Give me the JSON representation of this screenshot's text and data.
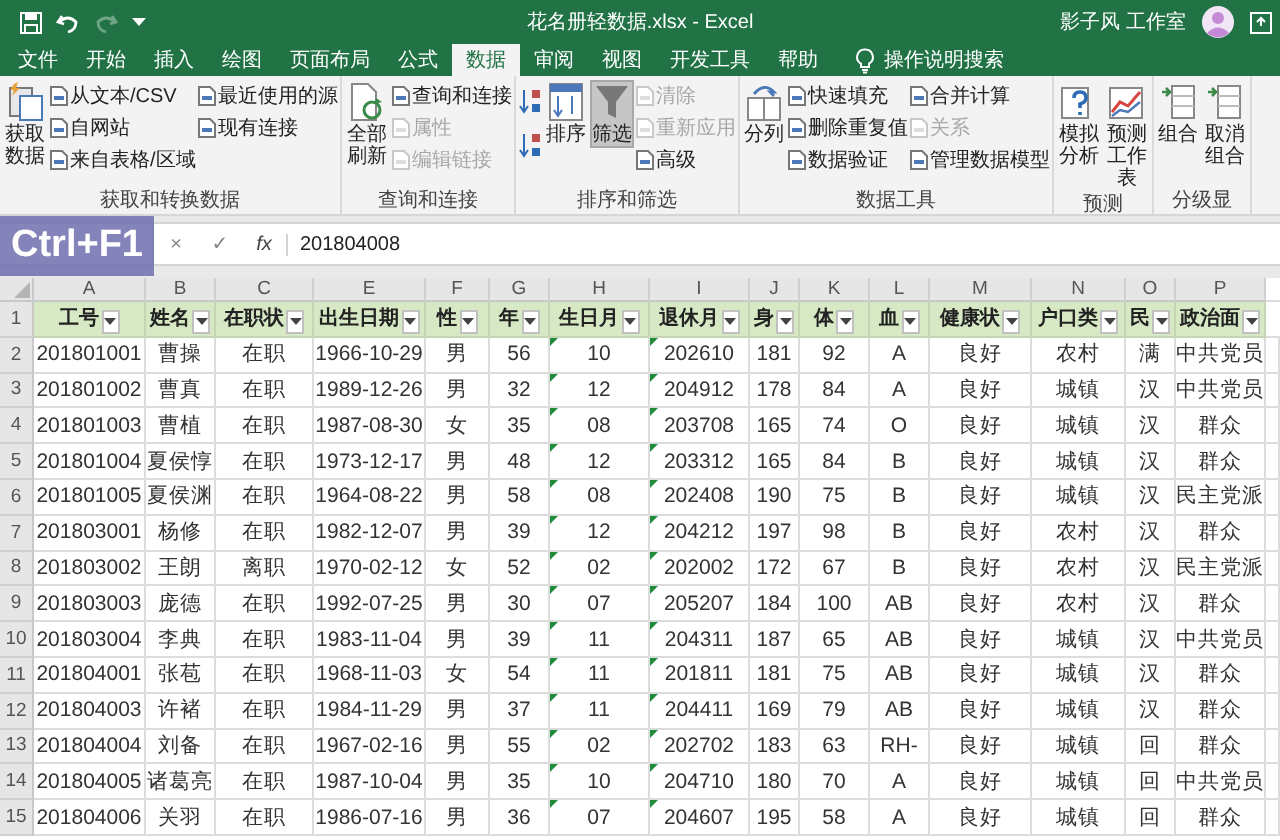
{
  "titlebar": {
    "title": "花名册轻数据.xlsx  -  Excel",
    "user": "影子风 工作室"
  },
  "tabs": [
    {
      "label": "文件",
      "selected": false
    },
    {
      "label": "开始",
      "selected": false
    },
    {
      "label": "插入",
      "selected": false
    },
    {
      "label": "绘图",
      "selected": false
    },
    {
      "label": "页面布局",
      "selected": false
    },
    {
      "label": "公式",
      "selected": false
    },
    {
      "label": "数据",
      "selected": true
    },
    {
      "label": "审阅",
      "selected": false
    },
    {
      "label": "视图",
      "selected": false
    },
    {
      "label": "开发工具",
      "selected": false
    },
    {
      "label": "帮助",
      "selected": false
    }
  ],
  "tell_me": "操作说明搜索",
  "ribbon": [
    {
      "label": "获取和转换数据",
      "items": [
        {
          "kind": "large",
          "label": "获取数据",
          "pressed": false
        },
        {
          "kind": "small",
          "label": "从文本/CSV",
          "disabled": false
        },
        {
          "kind": "small",
          "label": "自网站",
          "disabled": false
        },
        {
          "kind": "small",
          "label": "来自表格/区域",
          "disabled": false
        },
        {
          "kind": "small",
          "label": "最近使用的源",
          "disabled": false
        },
        {
          "kind": "small",
          "label": "现有连接",
          "disabled": false
        }
      ]
    },
    {
      "label": "查询和连接",
      "items": [
        {
          "kind": "large",
          "label": "全部刷新",
          "pressed": false
        },
        {
          "kind": "small",
          "label": "查询和连接",
          "disabled": false
        },
        {
          "kind": "small",
          "label": "属性",
          "disabled": true
        },
        {
          "kind": "small",
          "label": "编辑链接",
          "disabled": true
        }
      ]
    },
    {
      "label": "排序和筛选",
      "items": [
        {
          "kind": "sort"
        },
        {
          "kind": "sort"
        },
        {
          "kind": "large",
          "label": "排序",
          "pressed": false
        },
        {
          "kind": "large",
          "label": "筛选",
          "pressed": true
        },
        {
          "kind": "small",
          "label": "清除",
          "disabled": true
        },
        {
          "kind": "small",
          "label": "重新应用",
          "disabled": true
        },
        {
          "kind": "small",
          "label": "高级",
          "disabled": false
        }
      ]
    },
    {
      "label": "数据工具",
      "items": [
        {
          "kind": "large",
          "label": "分列",
          "pressed": false
        },
        {
          "kind": "small",
          "label": "快速填充",
          "disabled": false
        },
        {
          "kind": "small",
          "label": "删除重复值",
          "disabled": false
        },
        {
          "kind": "small",
          "label": "数据验证",
          "disabled": false
        },
        {
          "kind": "small",
          "label": "合并计算",
          "disabled": false
        },
        {
          "kind": "small",
          "label": "关系",
          "disabled": true
        },
        {
          "kind": "small",
          "label": "管理数据模型",
          "disabled": false
        }
      ]
    },
    {
      "label": "预测",
      "items": [
        {
          "kind": "large",
          "label": "模拟分析",
          "pressed": false
        },
        {
          "kind": "large",
          "label": "预测工作表",
          "pressed": false
        }
      ]
    },
    {
      "label": "分级显",
      "items": [
        {
          "kind": "large",
          "label": "组合",
          "pressed": false
        },
        {
          "kind": "large",
          "label": "取消组合",
          "pressed": false
        }
      ]
    }
  ],
  "formula_bar": {
    "shortcut_overlay": "Ctrl+F1",
    "cancel": "×",
    "enter": "✓",
    "function": "fx",
    "value": "201804008"
  },
  "sheet": {
    "header_row": "1",
    "columns": [
      {
        "letter": "A",
        "header": "工号",
        "text_number": false
      },
      {
        "letter": "B",
        "header": "姓名",
        "text_number": false
      },
      {
        "letter": "C",
        "header": "在职状",
        "text_number": false
      },
      {
        "letter": "E",
        "header": "出生日期",
        "text_number": false
      },
      {
        "letter": "F",
        "header": "性",
        "text_number": false
      },
      {
        "letter": "G",
        "header": "年",
        "text_number": false
      },
      {
        "letter": "H",
        "header": "生日月",
        "text_number": true
      },
      {
        "letter": "I",
        "header": "退休月",
        "text_number": true
      },
      {
        "letter": "J",
        "header": "身",
        "text_number": false
      },
      {
        "letter": "K",
        "header": "体",
        "text_number": false
      },
      {
        "letter": "L",
        "header": "血",
        "text_number": false
      },
      {
        "letter": "M",
        "header": "健康状",
        "text_number": false
      },
      {
        "letter": "N",
        "header": "户口类",
        "text_number": false
      },
      {
        "letter": "O",
        "header": "民",
        "text_number": false
      },
      {
        "letter": "P",
        "header": "政治面",
        "text_number": false
      }
    ],
    "rows": [
      {
        "number": "2",
        "cells": [
          "201801001",
          "曹操",
          "在职",
          "1966-10-29",
          "男",
          "56",
          "10",
          "202610",
          "181",
          "92",
          "A",
          "良好",
          "农村",
          "满",
          "中共党员"
        ]
      },
      {
        "number": "3",
        "cells": [
          "201801002",
          "曹真",
          "在职",
          "1989-12-26",
          "男",
          "32",
          "12",
          "204912",
          "178",
          "84",
          "A",
          "良好",
          "城镇",
          "汉",
          "中共党员"
        ]
      },
      {
        "number": "4",
        "cells": [
          "201801003",
          "曹植",
          "在职",
          "1987-08-30",
          "女",
          "35",
          "08",
          "203708",
          "165",
          "74",
          "O",
          "良好",
          "城镇",
          "汉",
          "群众"
        ]
      },
      {
        "number": "5",
        "cells": [
          "201801004",
          "夏侯惇",
          "在职",
          "1973-12-17",
          "男",
          "48",
          "12",
          "203312",
          "165",
          "84",
          "B",
          "良好",
          "城镇",
          "汉",
          "群众"
        ]
      },
      {
        "number": "6",
        "cells": [
          "201801005",
          "夏侯渊",
          "在职",
          "1964-08-22",
          "男",
          "58",
          "08",
          "202408",
          "190",
          "75",
          "B",
          "良好",
          "城镇",
          "汉",
          "民主党派"
        ]
      },
      {
        "number": "7",
        "cells": [
          "201803001",
          "杨修",
          "在职",
          "1982-12-07",
          "男",
          "39",
          "12",
          "204212",
          "197",
          "98",
          "B",
          "良好",
          "农村",
          "汉",
          "群众"
        ]
      },
      {
        "number": "8",
        "cells": [
          "201803002",
          "王朗",
          "离职",
          "1970-02-12",
          "女",
          "52",
          "02",
          "202002",
          "172",
          "67",
          "B",
          "良好",
          "农村",
          "汉",
          "民主党派"
        ]
      },
      {
        "number": "9",
        "cells": [
          "201803003",
          "庞德",
          "在职",
          "1992-07-25",
          "男",
          "30",
          "07",
          "205207",
          "184",
          "100",
          "AB",
          "良好",
          "农村",
          "汉",
          "群众"
        ]
      },
      {
        "number": "10",
        "cells": [
          "201803004",
          "李典",
          "在职",
          "1983-11-04",
          "男",
          "39",
          "11",
          "204311",
          "187",
          "65",
          "AB",
          "良好",
          "城镇",
          "汉",
          "中共党员"
        ]
      },
      {
        "number": "11",
        "cells": [
          "201804001",
          "张苞",
          "在职",
          "1968-11-03",
          "女",
          "54",
          "11",
          "201811",
          "181",
          "75",
          "AB",
          "良好",
          "城镇",
          "汉",
          "群众"
        ]
      },
      {
        "number": "12",
        "cells": [
          "201804003",
          "许褚",
          "在职",
          "1984-11-29",
          "男",
          "37",
          "11",
          "204411",
          "169",
          "79",
          "AB",
          "良好",
          "城镇",
          "汉",
          "群众"
        ]
      },
      {
        "number": "13",
        "cells": [
          "201804004",
          "刘备",
          "在职",
          "1967-02-16",
          "男",
          "55",
          "02",
          "202702",
          "183",
          "63",
          "RH-",
          "良好",
          "城镇",
          "回",
          "群众"
        ]
      },
      {
        "number": "14",
        "cells": [
          "201804005",
          "诸葛亮",
          "在职",
          "1987-10-04",
          "男",
          "35",
          "10",
          "204710",
          "180",
          "70",
          "A",
          "良好",
          "城镇",
          "回",
          "中共党员"
        ]
      },
      {
        "number": "15",
        "cells": [
          "201804006",
          "关羽",
          "在职",
          "1986-07-16",
          "男",
          "36",
          "07",
          "204607",
          "195",
          "58",
          "A",
          "良好",
          "城镇",
          "回",
          "群众"
        ]
      }
    ]
  }
}
